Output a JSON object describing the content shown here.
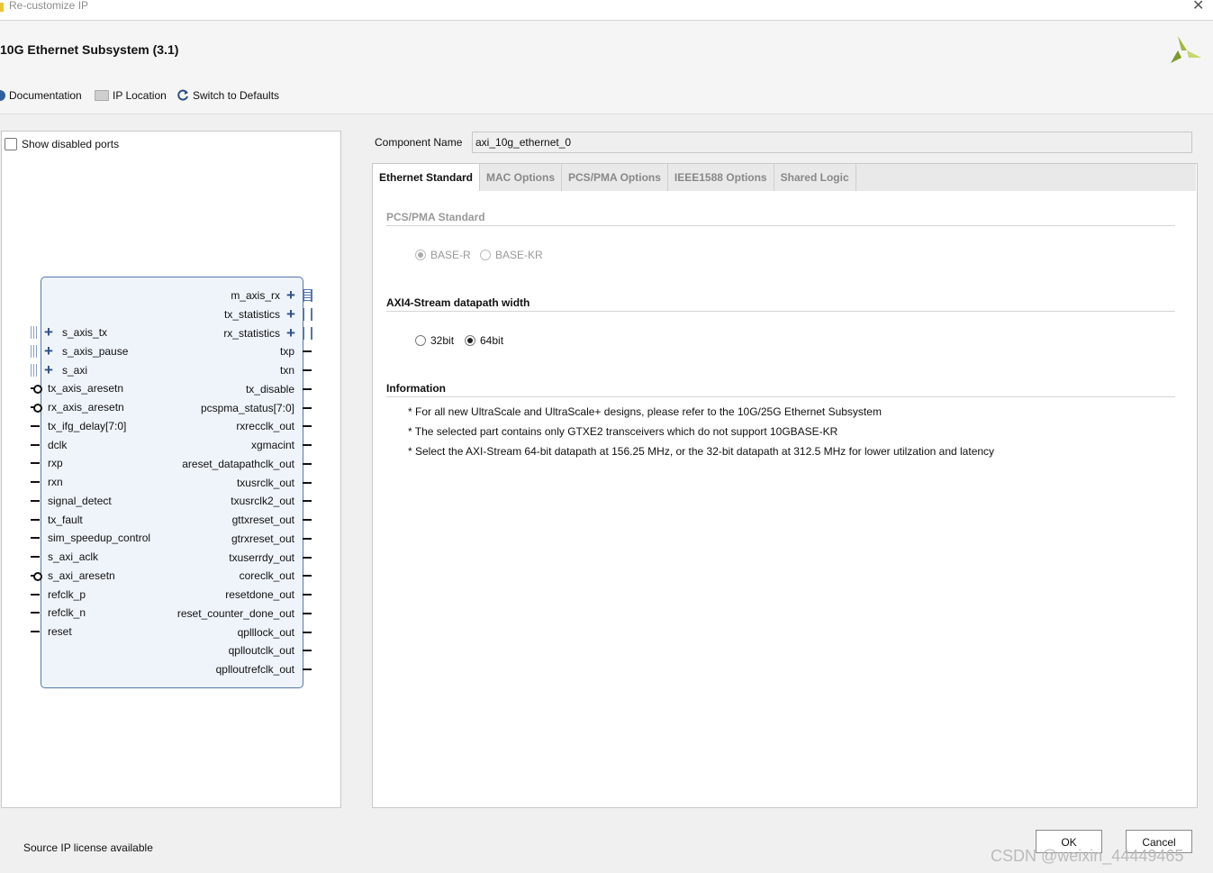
{
  "window": {
    "title": "Re-customize IP"
  },
  "header": {
    "ip_title": "10G Ethernet Subsystem (3.1)",
    "toolbar": {
      "documentation": "Documentation",
      "ip_location": "IP Location",
      "switch_defaults": "Switch to Defaults"
    }
  },
  "left_panel": {
    "show_disabled_ports": "Show disabled ports",
    "left_ports": [
      "s_axis_tx",
      "s_axis_pause",
      "s_axi",
      "tx_axis_aresetn",
      "rx_axis_aresetn",
      "tx_ifg_delay[7:0]",
      "dclk",
      "rxp",
      "rxn",
      "signal_detect",
      "tx_fault",
      "sim_speedup_control",
      "s_axi_aclk",
      "s_axi_aresetn",
      "refclk_p",
      "refclk_n",
      "reset"
    ],
    "right_ports": [
      "m_axis_rx",
      "tx_statistics",
      "rx_statistics",
      "txp",
      "txn",
      "tx_disable",
      "pcspma_status[7:0]",
      "rxrecclk_out",
      "xgmacint",
      "areset_datapathclk_out",
      "txusrclk_out",
      "txusrclk2_out",
      "gttxreset_out",
      "gtrxreset_out",
      "txuserrdy_out",
      "coreclk_out",
      "resetdone_out",
      "reset_counter_done_out",
      "qplllock_out",
      "qplloutclk_out",
      "qplloutrefclk_out"
    ]
  },
  "component": {
    "label": "Component Name",
    "value": "axi_10g_ethernet_0"
  },
  "tabs": [
    {
      "label": "Ethernet Standard"
    },
    {
      "label": "MAC Options"
    },
    {
      "label": "PCS/PMA Options"
    },
    {
      "label": "IEEE1588 Options"
    },
    {
      "label": "Shared Logic"
    }
  ],
  "ethernet_standard": {
    "pcs_section": "PCS/PMA Standard",
    "pcs_opt1": "BASE-R",
    "pcs_opt2": "BASE-KR",
    "axi_section": "AXI4-Stream datapath width",
    "axi_opt1": "32bit",
    "axi_opt2": "64bit",
    "info_section": "Information",
    "info_lines": [
      "* For all new UltraScale and UltraScale+ designs, please refer to the 10G/25G Ethernet Subsystem",
      "* The selected part contains only GTXE2 transceivers which do not support 10GBASE-KR",
      "* Select the AXI-Stream 64-bit datapath at 156.25 MHz, or the 32-bit datapath at 312.5 MHz for lower utilzation and latency"
    ]
  },
  "footer": {
    "license": "Source IP license available",
    "ok": "OK",
    "cancel": "Cancel"
  },
  "watermark": "CSDN @weixin_44449465",
  "colors": {
    "accent": "#2c4f86",
    "symbol_fill": "#eef4fa",
    "logo": "#9fb83a"
  }
}
